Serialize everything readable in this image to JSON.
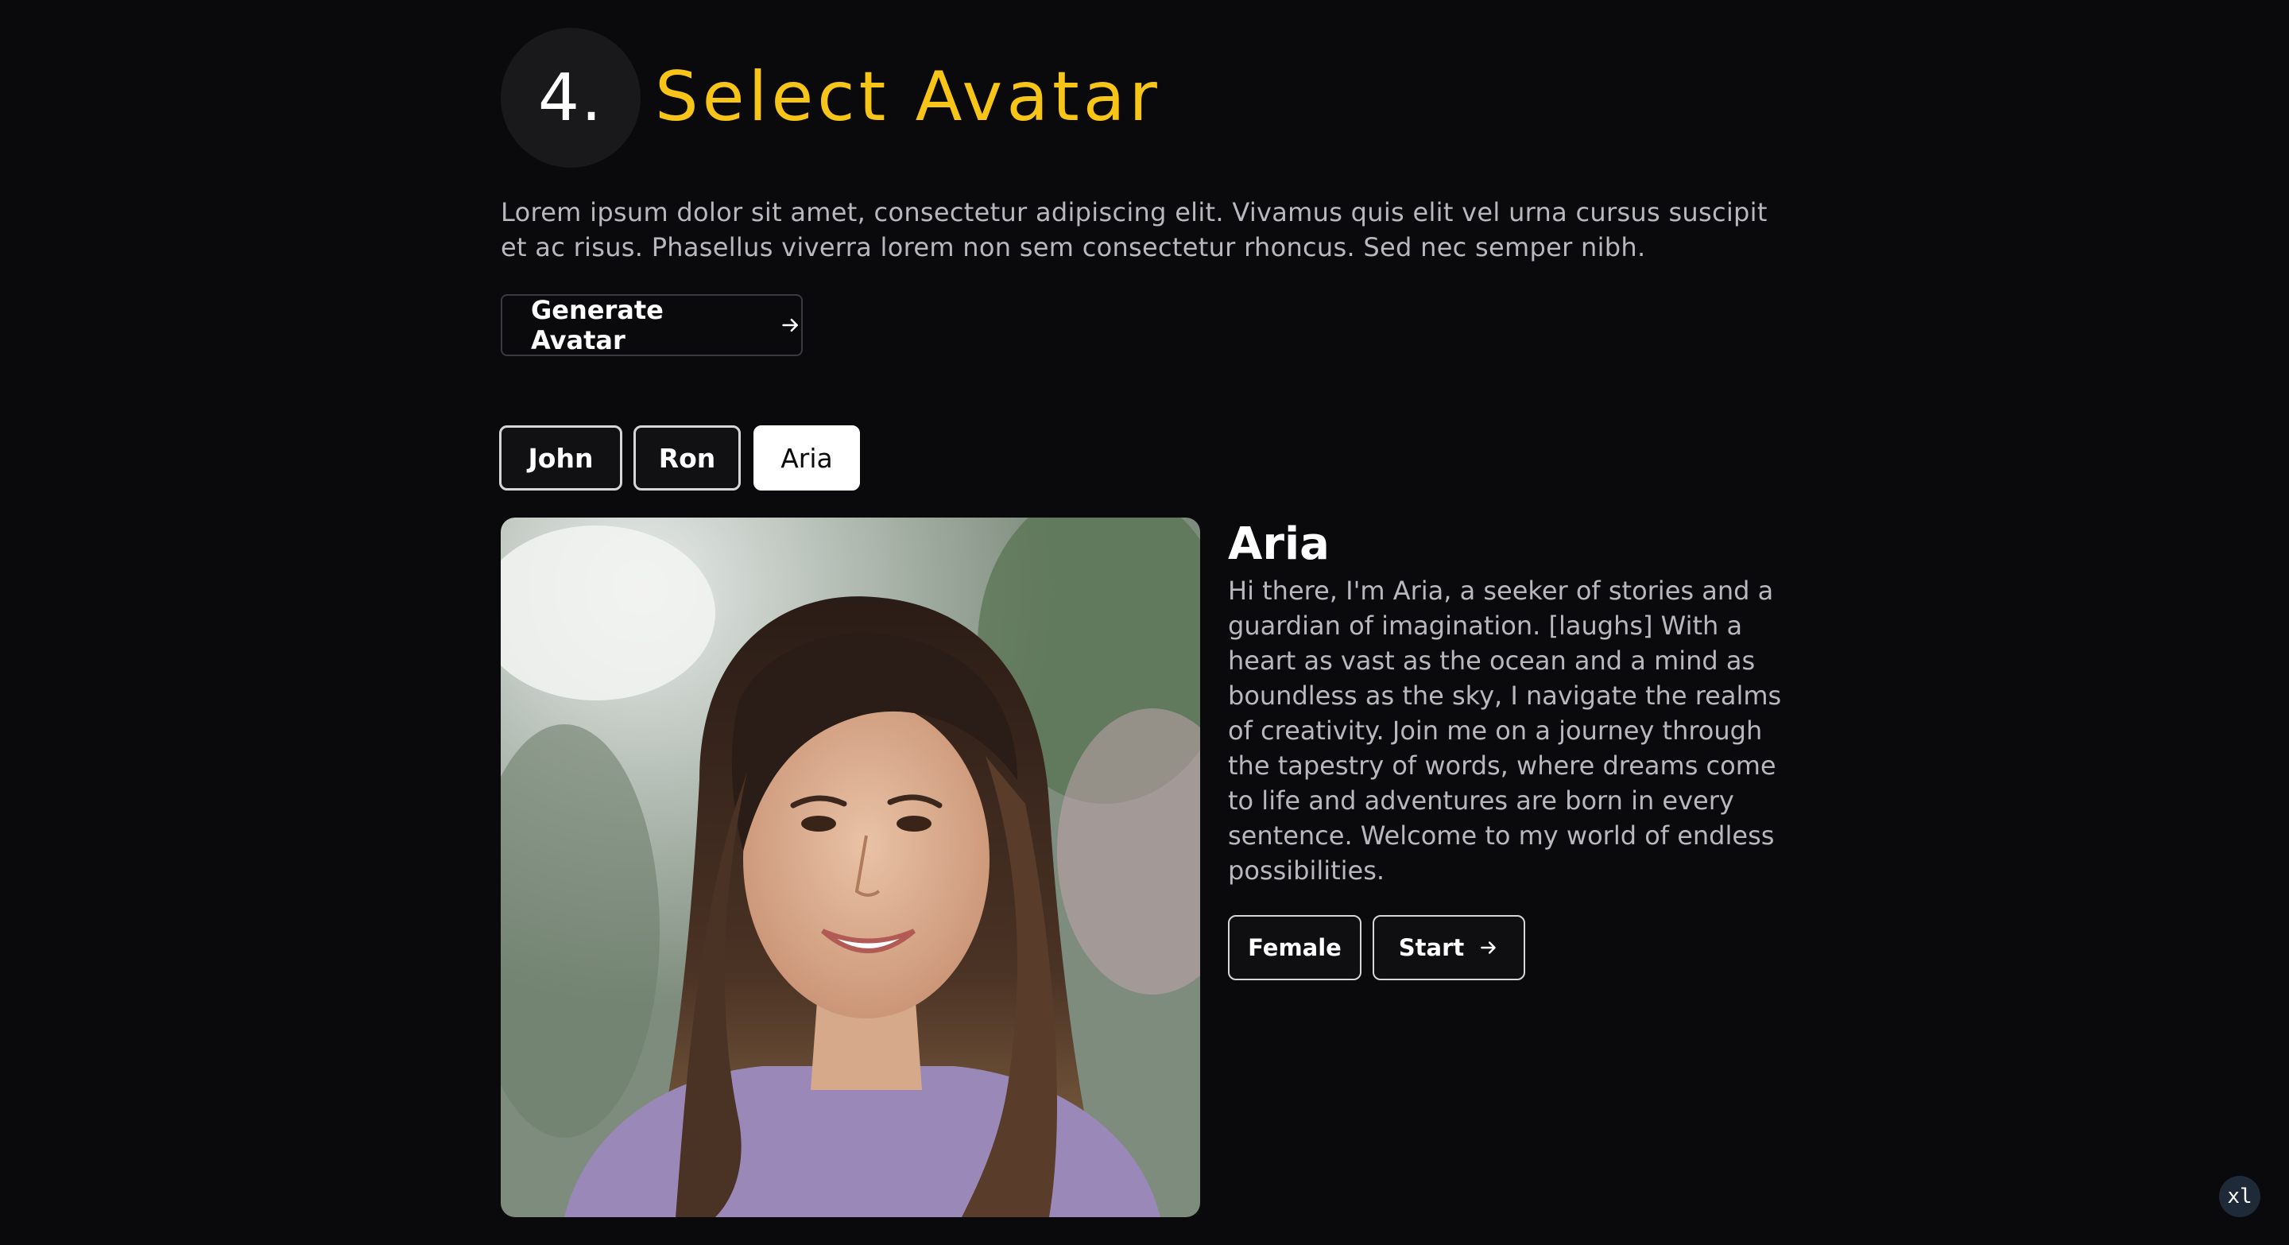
{
  "step": {
    "number": "4.",
    "title": "Select Avatar",
    "title_color": "#f7c517",
    "description": "Lorem ipsum dolor sit amet, consectetur adipiscing elit. Vivamus quis elit vel urna cursus suscipit et ac risus. Phasellus viverra lorem non sem consectetur rhoncus. Sed nec semper nibh."
  },
  "generate_button": {
    "label": "Generate Avatar",
    "icon": "arrow-right-icon"
  },
  "tabs": [
    {
      "label": "John",
      "active": false
    },
    {
      "label": "Ron",
      "active": false
    },
    {
      "label": "Aria",
      "active": true
    }
  ],
  "avatar": {
    "name": "Aria",
    "bio": "Hi there, I'm Aria, a seeker of stories and a guardian of imagination. [laughs] With a heart as vast as the ocean and a mind as boundless as the sky, I navigate the realms of creativity. Join me on a journey through the tapestry of words, where dreams come to life and adventures are born in every sentence. Welcome to my world of endless possibilities.",
    "gender_label": "Female",
    "start_label": "Start",
    "start_icon": "arrow-right-icon"
  },
  "corner_badge": "xl"
}
